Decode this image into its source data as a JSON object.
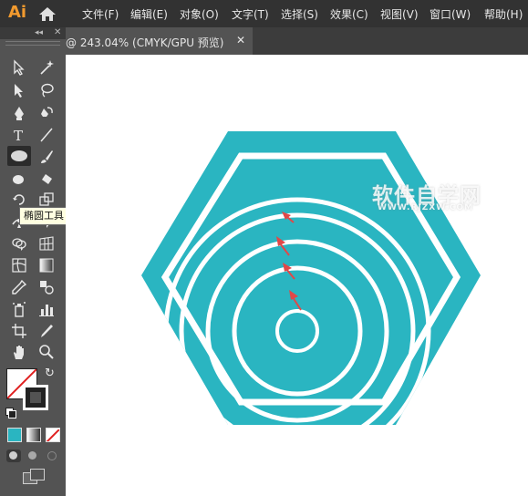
{
  "app": {
    "logo": "Ai",
    "menu": [
      "文件(F)",
      "编辑(E)",
      "对象(O)",
      "文字(T)",
      "选择(S)",
      "效果(C)",
      "视图(V)",
      "窗口(W)",
      "帮助(H)"
    ]
  },
  "document_tab": {
    "title": "@ 243.04% (CMYK/GPU 预览)",
    "close_glyph": "✕"
  },
  "toolbar": {
    "collapse_glyph": "◂◂",
    "close_glyph": "✕",
    "tooltip": "椭圆工具 (L)",
    "active_tool": "ellipse-tool",
    "tools": [
      "selection-tool",
      "direct-selection-tool",
      "magic-wand-tool",
      "lasso-tool",
      "pen-tool",
      "curvature-tool",
      "type-tool",
      "line-segment-tool",
      "ellipse-tool",
      "paintbrush-tool",
      "shaper-tool",
      "eraser-tool",
      "rotate-tool",
      "scale-tool",
      "width-tool",
      "free-transform-tool",
      "shape-builder-tool",
      "puppet-warp-tool",
      "perspective-grid-tool",
      "mesh-tool",
      "gradient-tool",
      "eyedropper-tool",
      "blend-tool",
      "symbol-sprayer-tool",
      "column-graph-tool",
      "artboard-tool",
      "slice-tool",
      "hand-tool",
      "zoom-tool"
    ]
  },
  "colors": {
    "fill": "#ffffff",
    "stroke": "#000000",
    "teal": "#2ab5c1",
    "arrow": "#e04848",
    "ui_dark": "#323232",
    "ui_mid": "#535353"
  },
  "watermark": {
    "main": "软件自学网",
    "url": "WWW.RJZXW.COM"
  }
}
